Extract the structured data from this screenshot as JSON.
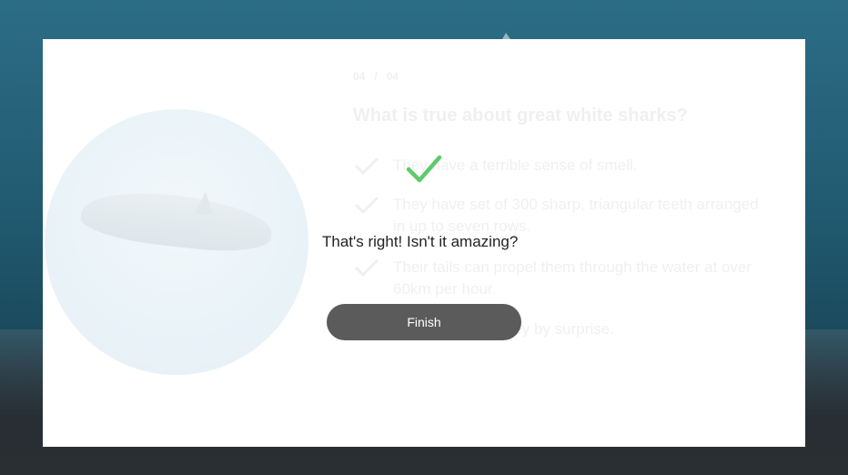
{
  "quiz": {
    "counter_current": "04",
    "counter_separator": "/",
    "counter_total": "04",
    "question": "What is true about great white sharks?",
    "answers": [
      {
        "text": "They have a terrible sense of smell."
      },
      {
        "text": "They have set of 300 sharp, triangular teeth arranged in up to seven rows."
      },
      {
        "text": "Their tails can propel them through the water at over 60km per hour."
      },
      {
        "text": "They take their prey by surprise."
      }
    ]
  },
  "feedback": {
    "icon": "checkmark-icon",
    "message": "That's right! Isn't it amazing?",
    "finish_label": "Finish"
  },
  "colors": {
    "accent_green": "#5fca6a",
    "button_bg": "#5b5b5b"
  }
}
